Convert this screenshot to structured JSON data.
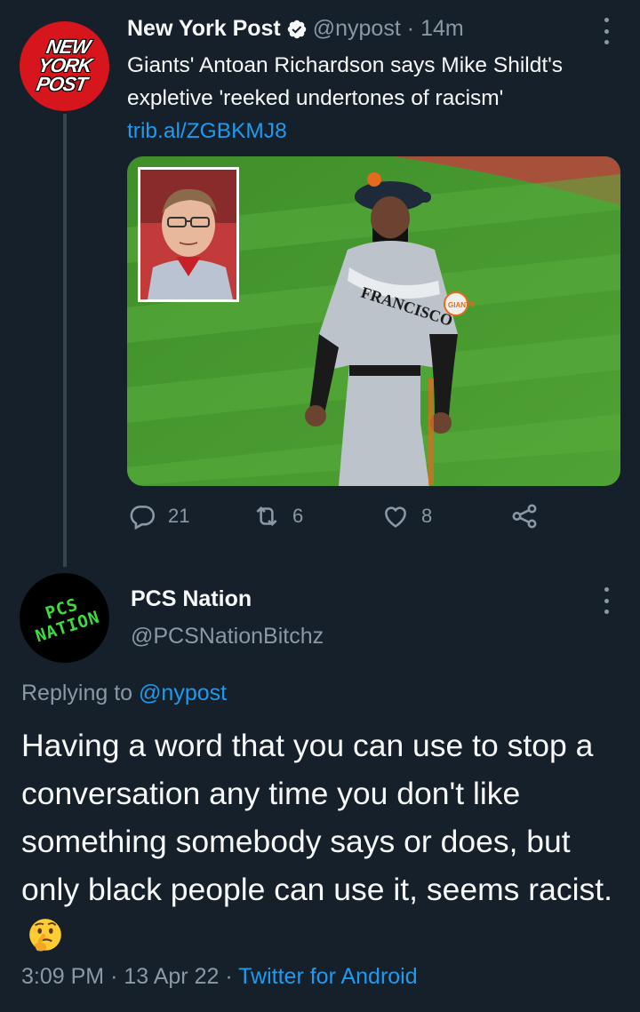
{
  "parent_tweet": {
    "avatar_text": [
      "NEW",
      "YORK",
      "POST"
    ],
    "name": "New York Post",
    "handle": "@nypost",
    "separator": "·",
    "time": "14m",
    "text": "Giants' Antoan Richardson says Mike Shildt's expletive 'reeked undertones of racism'",
    "link": "trib.al/ZGBKMJ8",
    "photo_description_jersey": "FRANCISCO",
    "photo_patch": "GIANTS",
    "stats": {
      "replies": "21",
      "retweets": "6",
      "likes": "8"
    }
  },
  "reply_tweet": {
    "avatar_text": [
      "PCS",
      "NATION"
    ],
    "name": "PCS Nation",
    "handle": "@PCSNationBitchz",
    "replying_to_label": "Replying to",
    "replying_to_handle": "@nypost",
    "text": "Having a word that you can use to stop a conversation any time you don't like something somebody says or does, but only black people can use it, seems racist.",
    "emoji": "thinking-face",
    "time": "3:09 PM",
    "separator": "·",
    "date": "13 Apr 22",
    "source": "Twitter for Android"
  },
  "colors": {
    "background": "#15202b",
    "text": "#f7f9f9",
    "secondary": "#8b98a5",
    "link": "#1d9bf0",
    "nyp_red": "#d6151c",
    "pcs_green": "#3ddc3d"
  }
}
